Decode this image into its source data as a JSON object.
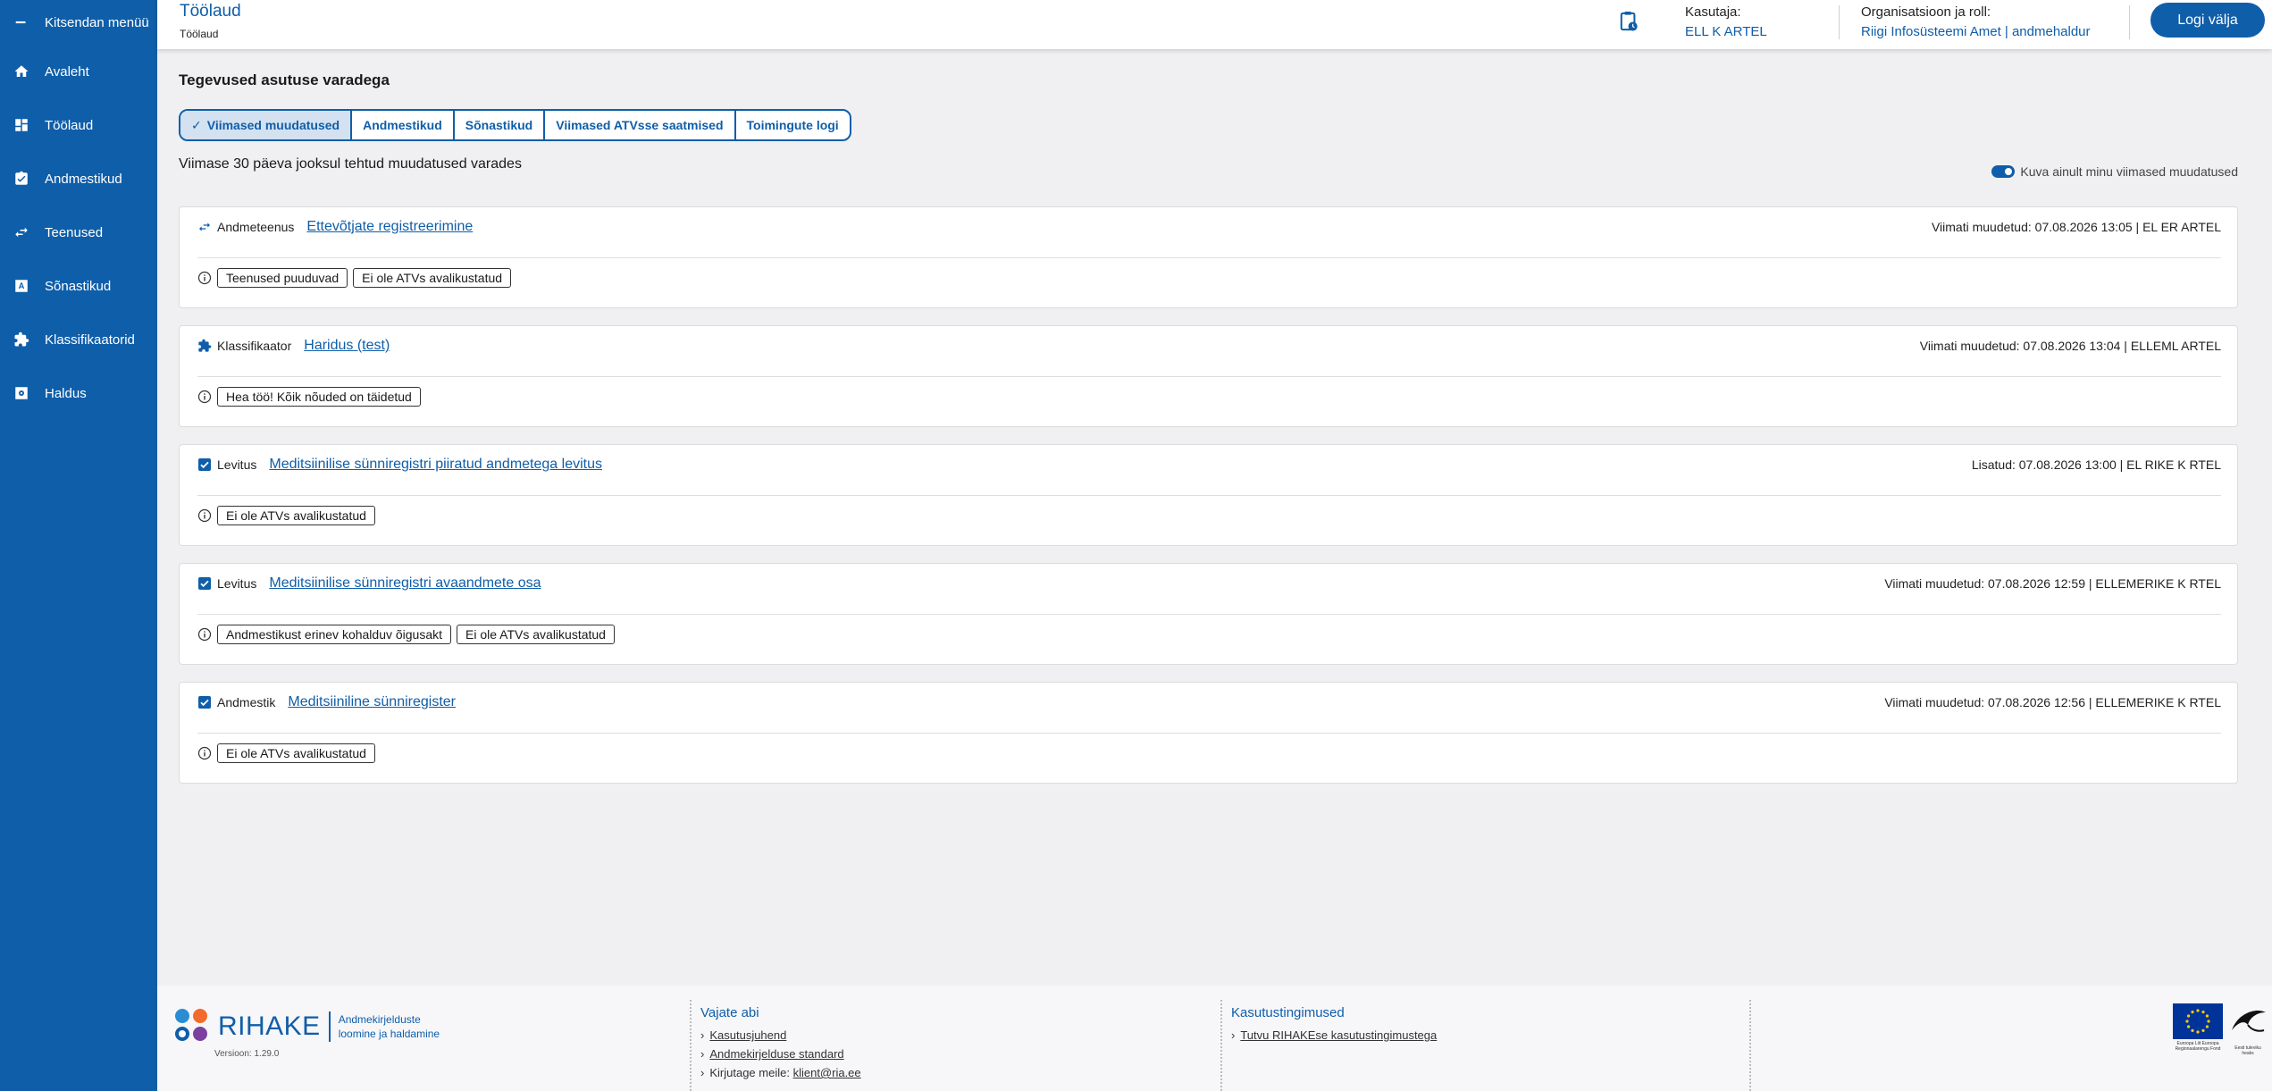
{
  "sidebar": {
    "menu_toggle": "Kitsendan menüü",
    "items": [
      {
        "label": "Avaleht",
        "icon": "home-icon"
      },
      {
        "label": "Töölaud",
        "icon": "dashboard-icon"
      },
      {
        "label": "Andmestikud",
        "icon": "clipboard-check-icon"
      },
      {
        "label": "Teenused",
        "icon": "swap-icon"
      },
      {
        "label": "Sõnastikud",
        "icon": "dictionary-icon"
      },
      {
        "label": "Klassifikaatorid",
        "icon": "puzzle-icon"
      },
      {
        "label": "Haldus",
        "icon": "admin-icon"
      }
    ]
  },
  "header": {
    "title": "Töölaud",
    "breadcrumb": "Töölaud",
    "user_label": "Kasutaja:",
    "user_value": "ELL        K ARTEL",
    "org_label": "Organisatsioon ja roll:",
    "org_value": "Riigi Infosüsteemi Amet | andmehaldur",
    "logout": "Logi välja"
  },
  "main": {
    "title": "Tegevused asutuse varadega",
    "tabs": [
      {
        "label": "Viimased muudatused",
        "active": true
      },
      {
        "label": "Andmestikud",
        "active": false
      },
      {
        "label": "Sõnastikud",
        "active": false
      },
      {
        "label": "Viimased ATVsse saatmised",
        "active": false
      },
      {
        "label": "Toimingute logi",
        "active": false
      }
    ],
    "subtitle": "Viimase 30 päeva jooksul tehtud muudatused varades",
    "toggle_label": "Kuva ainult minu viimased muudatused",
    "toggle_on": true,
    "cards": [
      {
        "type": "Andmeteenus",
        "icon": "swap-icon",
        "link": "Ettevõtjate registreerimine",
        "meta": "Viimati muudetud: 07.08.2026 13:05 | EL      ER      ARTEL",
        "badges": [
          "Teenused puuduvad",
          "Ei ole ATVs avalikustatud"
        ]
      },
      {
        "type": "Klassifikaator",
        "icon": "puzzle-icon",
        "link": "Haridus (test)",
        "meta": "Viimati muudetud: 07.08.2026 13:04 | ELLEML      ARTEL",
        "badges": [
          "Hea töö! Kõik nõuded on täidetud"
        ]
      },
      {
        "type": "Levitus",
        "icon": "checkbox-icon",
        "link": "Meditsiinilise sünniregistri piiratud andmetega levitus",
        "meta": "Lisatud: 07.08.2026 13:00 | EL      RIKE K   RTEL",
        "badges": [
          "Ei ole ATVs avalikustatud"
        ]
      },
      {
        "type": "Levitus",
        "icon": "checkbox-icon",
        "link": "Meditsiinilise sünniregistri avaandmete osa",
        "meta": "Viimati muudetud: 07.08.2026 12:59 | ELLEMERIKE K   RTEL",
        "badges": [
          "Andmestikust erinev kohalduv õigusakt",
          "Ei ole ATVs avalikustatud"
        ]
      },
      {
        "type": "Andmestik",
        "icon": "checkbox-icon",
        "link": "Meditsiiniline sünniregister",
        "meta": "Viimati muudetud: 07.08.2026 12:56 | ELLEMERIKE K   RTEL",
        "badges": [
          "Ei ole ATVs avalikustatud"
        ]
      }
    ]
  },
  "footer": {
    "logo_name": "RIHAKE",
    "logo_desc_1": "Andmekirjelduste",
    "logo_desc_2": "loomine ja haldamine",
    "version": "Versioon: 1.29.0",
    "help_title": "Vajate abi",
    "help_links": [
      "Kasutusjuhend",
      "Andmekirjelduse standard"
    ],
    "email_prefix": "Kirjutage meile:",
    "email": "klient@ria.ee",
    "terms_title": "Kasutustingimused",
    "terms_link": "Tutvu RIHAKEse kasutustingimustega",
    "eu_text": "Euroopa Liit Euroopa Regionaalarengu Fond",
    "ee_text": "Eesti tuleviku heaks"
  },
  "colors": {
    "primary": "#0f5ea9",
    "tab_active": "#d3e1f0",
    "background": "#f0f0f2"
  }
}
